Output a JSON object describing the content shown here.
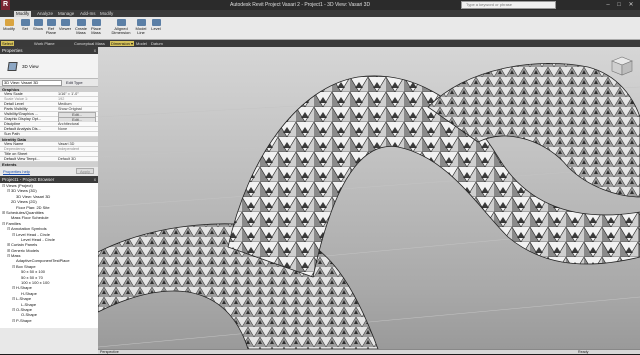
{
  "app": {
    "logo": "R",
    "title": "Autodesk Revit Project Vasari 2 -    Project1 - 3D View: Vasari 3D"
  },
  "search": {
    "placeholder": "Type a keyword or phrase"
  },
  "window_buttons": [
    "–",
    "□",
    "✕"
  ],
  "ribbon_tabs": [
    {
      "label": "Modify",
      "active": true
    },
    {
      "label": "Analyze"
    },
    {
      "label": "Manage"
    },
    {
      "label": "Add-Ins"
    },
    {
      "label": "Modify"
    }
  ],
  "ribbon_buttons": [
    {
      "label": "Modify",
      "icon": "cursor-arrow-icon"
    },
    {
      "label": "Set",
      "icon": "set-workplane-icon"
    },
    {
      "label": "Show",
      "icon": "show-workplane-icon"
    },
    {
      "label": "Ref Plane",
      "icon": "ref-plane-icon"
    },
    {
      "label": "Viewer",
      "icon": "viewer-icon"
    },
    {
      "label": "Create Mass",
      "icon": "create-mass-icon"
    },
    {
      "label": "Place Mass",
      "icon": "place-mass-icon"
    },
    {
      "label": "Aligned Dimension",
      "icon": "aligned-dimension-icon"
    },
    {
      "label": "Model Line",
      "icon": "model-line-icon"
    },
    {
      "label": "Level",
      "icon": "level-icon"
    }
  ],
  "ribbon_panels": [
    "Select",
    "Work Plane",
    "Conceptual Mass",
    "Dimension ▾",
    "Model",
    "Datum"
  ],
  "properties": {
    "title": "Properties",
    "close": "x",
    "type_name": "3D View",
    "instance_select": "3D View: Vasari 3D",
    "edit_type": "Edit Type",
    "groups": [
      {
        "name": "Graphics",
        "rows": [
          {
            "k": "View Scale",
            "v": "1/16\" = 1'-0\""
          },
          {
            "k": "Scale Value  1:",
            "v": "192",
            "grey": true
          },
          {
            "k": "Detail Level",
            "v": "Medium"
          },
          {
            "k": "Parts Visibility",
            "v": "Show Original"
          },
          {
            "k": "Visibility/Graphics ...",
            "v": "Edit...",
            "btn": true
          },
          {
            "k": "Graphic Display Opt...",
            "v": "Edit...",
            "btn": true
          },
          {
            "k": "Discipline",
            "v": "Architectural"
          },
          {
            "k": "Default Analysis Dis...",
            "v": "None"
          },
          {
            "k": "Sun Path",
            "v": ""
          }
        ]
      },
      {
        "name": "Identity Data",
        "rows": [
          {
            "k": "View Name",
            "v": "Vasari 3D"
          },
          {
            "k": "Dependency",
            "v": "Independent",
            "grey": true
          },
          {
            "k": "Title on Sheet",
            "v": ""
          },
          {
            "k": "Default View Templ...",
            "v": "Default 3D"
          }
        ]
      },
      {
        "name": "Extents",
        "rows": []
      }
    ],
    "help_link": "Properties help",
    "apply": "Apply"
  },
  "browser": {
    "title": "Project1 - Project Browser",
    "close": "x",
    "items": [
      {
        "t": "⊟",
        "label": "Views (Project)",
        "d": 0
      },
      {
        "t": "⊟",
        "label": "3D Views (3D)",
        "d": 1
      },
      {
        "t": "",
        "label": "3D View: Vasari 3D",
        "d": 2
      },
      {
        "t": "",
        "label": "2D Views (2D)",
        "d": 1
      },
      {
        "t": "",
        "label": "Floor Plan: 2D Site",
        "d": 2
      },
      {
        "t": "⊞",
        "label": "Schedules/Quantities",
        "d": 0
      },
      {
        "t": "",
        "label": "Mass Floor Schedule",
        "d": 1
      },
      {
        "t": "⊟",
        "label": "Families",
        "d": 0
      },
      {
        "t": "⊟",
        "label": "Annotation Symbols",
        "d": 1
      },
      {
        "t": "⊟",
        "label": "Level Head - Circle",
        "d": 2
      },
      {
        "t": "",
        "label": "Level Head - Circle",
        "d": 3
      },
      {
        "t": "⊞",
        "label": "Curtain Panels",
        "d": 1
      },
      {
        "t": "⊞",
        "label": "Generic Models",
        "d": 1
      },
      {
        "t": "⊟",
        "label": "Mass",
        "d": 1
      },
      {
        "t": "",
        "label": "AdaptiveComponentTestPlace",
        "d": 2
      },
      {
        "t": "⊟",
        "label": "Box Shape",
        "d": 2
      },
      {
        "t": "",
        "label": "50 x 50 x 100",
        "d": 3
      },
      {
        "t": "",
        "label": "50 x 50 x 70",
        "d": 3
      },
      {
        "t": "",
        "label": "100 x 100 x 100",
        "d": 3
      },
      {
        "t": "⊟",
        "label": "H-Shape",
        "d": 2
      },
      {
        "t": "",
        "label": "H-Shape",
        "d": 3
      },
      {
        "t": "⊟",
        "label": "L-Shape",
        "d": 2
      },
      {
        "t": "",
        "label": "L-Shape",
        "d": 3
      },
      {
        "t": "⊟",
        "label": "O-Shape",
        "d": 2
      },
      {
        "t": "",
        "label": "O-Shape",
        "d": 3
      },
      {
        "t": "⊟",
        "label": "P-Shape",
        "d": 2
      }
    ]
  },
  "status": {
    "scale": "Perspective",
    "ready": "Ready"
  }
}
